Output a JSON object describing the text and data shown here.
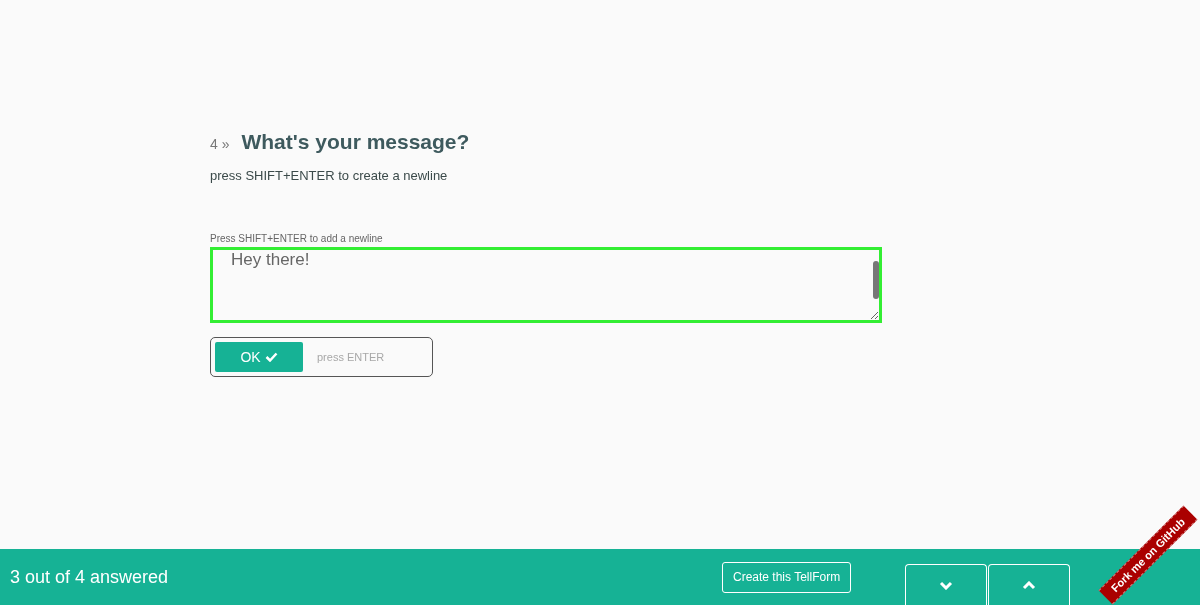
{
  "question": {
    "number": "4",
    "marker": "»",
    "title": "What's your message?",
    "description": "press SHIFT+ENTER to create a newline"
  },
  "field": {
    "label": "Press SHIFT+ENTER to add a newline",
    "value": "Hey there!\n",
    "focused": true
  },
  "submit": {
    "label": "OK",
    "hint": "press ENTER"
  },
  "footer": {
    "progress": "3 out of 4 answered",
    "create_button": "Create this TellForm"
  },
  "ribbon": {
    "label": "Fork me on GitHub"
  }
}
